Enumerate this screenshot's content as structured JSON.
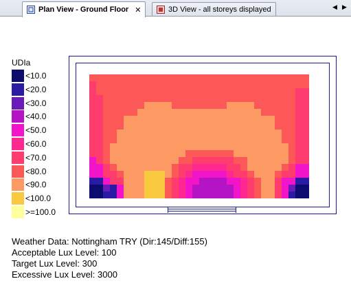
{
  "tabs": [
    {
      "label": "Plan View - Ground Floor",
      "active": true,
      "icon": "plan-view-icon",
      "close": "✕"
    },
    {
      "label": "3D View - all storeys displayed",
      "active": false,
      "icon": "3d-view-icon"
    }
  ],
  "legend": {
    "title": "UDIa",
    "items": [
      {
        "label": "<10.0",
        "color": "#0c0c6e"
      },
      {
        "label": "<20.0",
        "color": "#2a1aa4"
      },
      {
        "label": "<30.0",
        "color": "#6a1ab8"
      },
      {
        "label": "<40.0",
        "color": "#b414c4"
      },
      {
        "label": "<50.0",
        "color": "#f214c8"
      },
      {
        "label": "<60.0",
        "color": "#ff2890"
      },
      {
        "label": "<70.0",
        "color": "#ff3c6e"
      },
      {
        "label": "<80.0",
        "color": "#fd5858"
      },
      {
        "label": "<90.0",
        "color": "#fd9a64"
      },
      {
        "label": "<100.0",
        "color": "#f8c83e"
      },
      {
        "label": ">=100.0",
        "color": "#fefe9a"
      }
    ]
  },
  "grid_rows": [
    "77777777777777777777777777777777",
    "67777777777777777777777777777777",
    "67777777777777777777777777777766",
    "66777777777777777777777777777766",
    "66777777888877777777888877777766",
    "66777778888888888888888887777766",
    "66777888888888888888888888877766",
    "66777888888888888888888888877766",
    "66778888888888888888888888887766",
    "66778888888888888888888888887766",
    "66788888888888888888888888888766",
    "66788888888888777777788888888766",
    "46788888888887766666677888888766",
    "44678888888876655555667888887644",
    "44667888999876544444566788876644",
    "11466888999765443333445678864411",
    "00214888999765433333345678864200",
    "00114888999765433333345678864100"
  ],
  "info": {
    "weather": "Weather Data: Nottingham TRY (Dir:145/Diff:155)",
    "acceptable": "Acceptable Lux Level: 100",
    "target": "Target Lux Level: 300",
    "excessive": "Excessive Lux Level: 3000"
  }
}
